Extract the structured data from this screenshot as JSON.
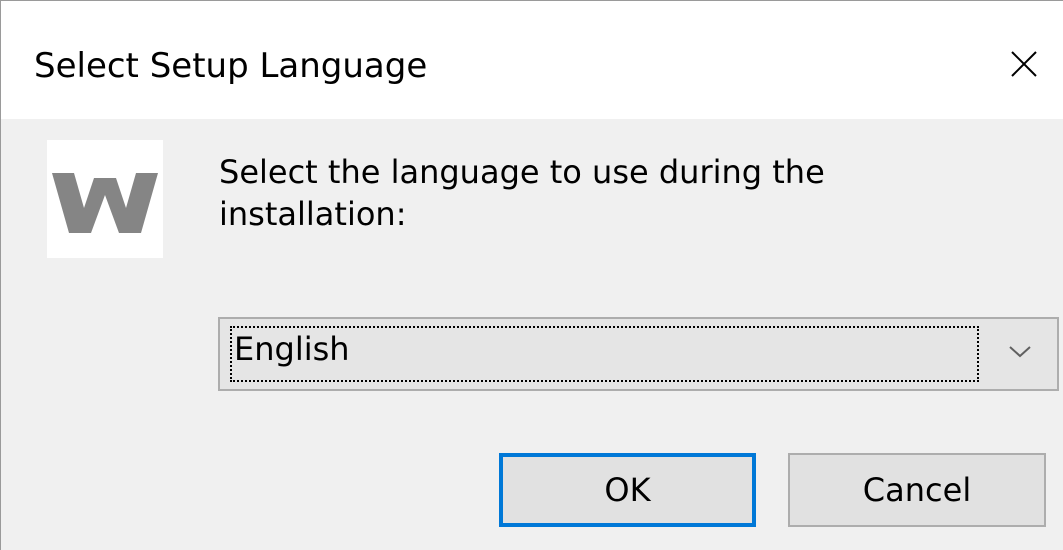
{
  "window": {
    "title": "Select Setup Language",
    "close_icon": "close-icon"
  },
  "logo": {
    "icon": "w-logo-icon",
    "letter": "W",
    "color": "#858585"
  },
  "prompt": {
    "text": "Select the language to use during the installation:"
  },
  "language_select": {
    "value": "English",
    "icon": "chevron-down-icon"
  },
  "buttons": {
    "ok_label": "OK",
    "cancel_label": "Cancel"
  },
  "colors": {
    "focus_accent": "#0078d7",
    "dialog_background": "#f0f0f0",
    "titlebar_background": "#ffffff"
  }
}
